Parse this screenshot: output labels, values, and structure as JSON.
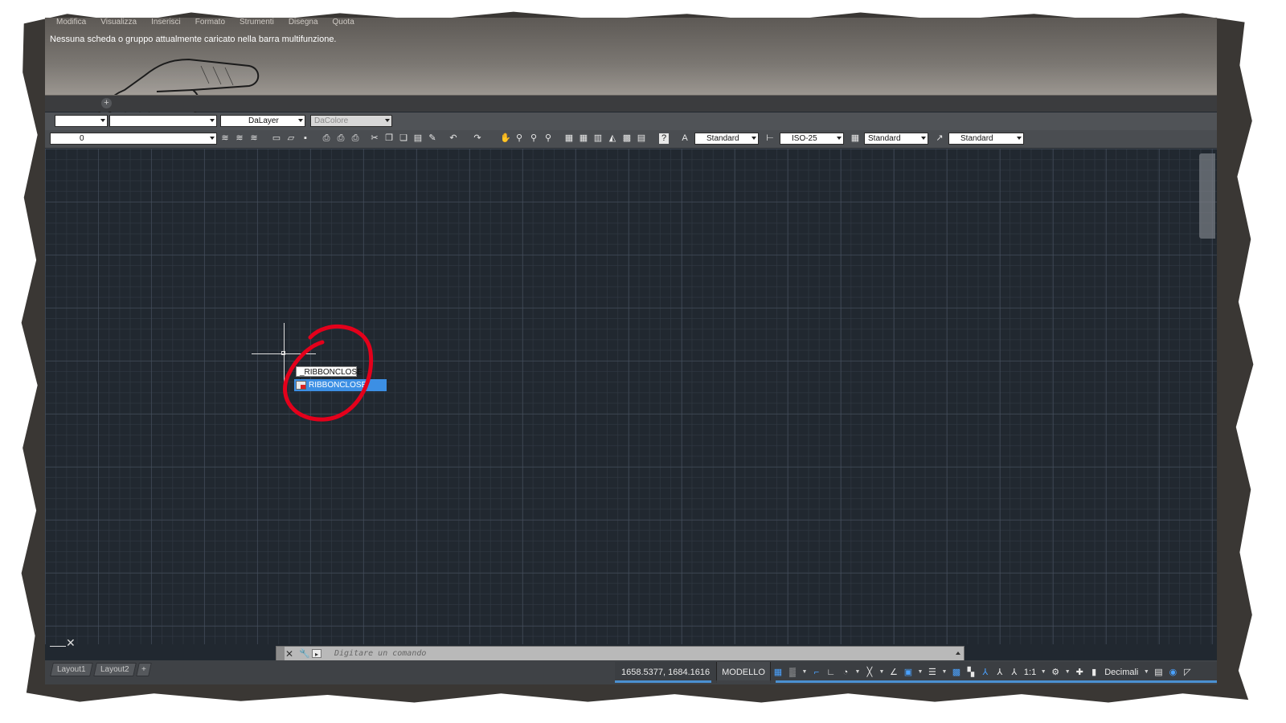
{
  "menubar": {
    "items": [
      "Modifica",
      "Visualizza",
      "Inserisci",
      "Formato",
      "Strumenti",
      "Disegna",
      "Quota"
    ]
  },
  "ribbon": {
    "message": "Nessuna scheda o gruppo attualmente caricato nella barra multifunzione.",
    "new_tab_label": "+"
  },
  "toolbar1": {
    "linetype_value": "DaLayer",
    "color_value": "DaColore"
  },
  "toolbar2": {
    "layer_value": "0",
    "text_style_value": "Standard",
    "dim_style_value": "ISO-25",
    "table_style_value": "Standard",
    "mleader_style_value": "Standard"
  },
  "dynamic_input": {
    "value": "_RIBBONCLOSE"
  },
  "autocomplete": {
    "items": [
      {
        "label": "RIBBONCLOSE",
        "icon": "command-icon",
        "selected": true
      }
    ]
  },
  "command_line": {
    "placeholder": "Digitare un comando",
    "close": "✕",
    "customize": "🔧"
  },
  "layout_tabs": {
    "tabs": [
      "Layout1",
      "Layout2"
    ],
    "add": "+"
  },
  "status": {
    "coordinates": "1658.5377, 1684.1616",
    "space": "MODELLO",
    "scale": "1:1",
    "units": "Decimali"
  },
  "ucs": {
    "symbol": "✕"
  },
  "colors": {
    "canvas": "#212830",
    "highlight": "#3c8fe4",
    "annotation": "#e4001b"
  }
}
